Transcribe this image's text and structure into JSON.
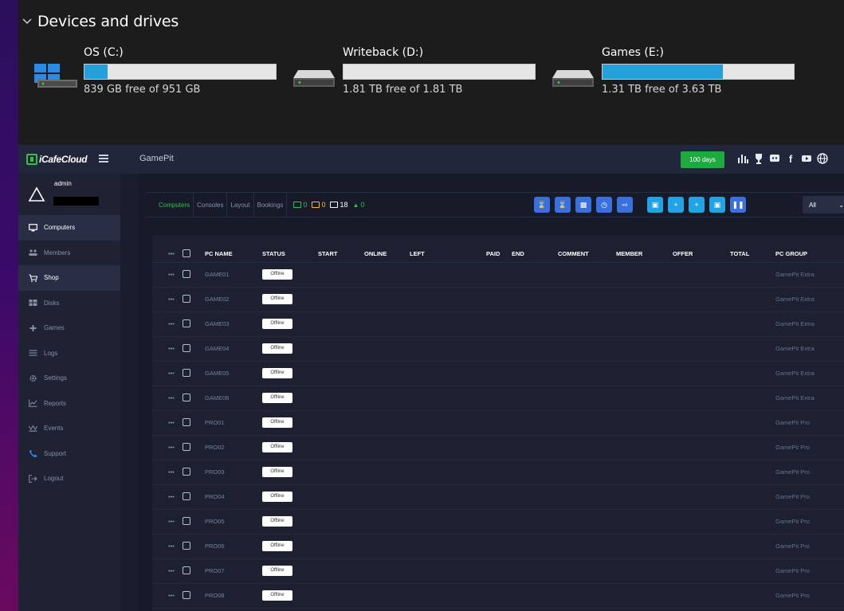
{
  "explorer": {
    "section_title": "Devices and drives",
    "drives": [
      {
        "name": "OS (C:)",
        "free_text": "839 GB free of 951 GB",
        "used_fraction": 0.12,
        "icon": "windows-drive-icon"
      },
      {
        "name": "Writeback (D:)",
        "free_text": "1.81 TB free of 1.81 TB",
        "used_fraction": 0.0,
        "icon": "hard-drive-icon"
      },
      {
        "name": "Games (E:)",
        "free_text": "1.31 TB free of 3.63 TB",
        "used_fraction": 0.63,
        "icon": "hard-drive-icon"
      }
    ]
  },
  "app": {
    "brand": "iCafeCloud",
    "cafe_name": "GamePit",
    "days_badge": "100 days",
    "top_icons": [
      "leaderboard-icon",
      "trophy-icon",
      "discord-icon",
      "facebook-icon",
      "youtube-icon",
      "globe-icon"
    ]
  },
  "profile": {
    "username": "admin"
  },
  "sidebar": {
    "items": [
      {
        "label": "Computers",
        "icon": "monitor-icon"
      },
      {
        "label": "Members",
        "icon": "members-icon"
      },
      {
        "label": "Shop",
        "icon": "cart-icon"
      },
      {
        "label": "Disks",
        "icon": "disk-icon"
      },
      {
        "label": "Games",
        "icon": "gamepad-icon"
      },
      {
        "label": "Logs",
        "icon": "list-icon"
      },
      {
        "label": "Settings",
        "icon": "gear-icon"
      },
      {
        "label": "Reports",
        "icon": "chart-icon"
      },
      {
        "label": "Events",
        "icon": "crown-icon"
      },
      {
        "label": "Support",
        "icon": "phone-icon"
      },
      {
        "label": "Logout",
        "icon": "logout-icon"
      }
    ]
  },
  "toolbar": {
    "tabs": [
      "Computers",
      "Consoles",
      "Layout",
      "Bookings"
    ],
    "stats": [
      {
        "value": "0",
        "color": "#2fc24a"
      },
      {
        "value": "0",
        "color": "#f2c21b"
      },
      {
        "value": "18",
        "color": "#ffffff"
      },
      {
        "value": "0",
        "color": "#2fc24a"
      }
    ],
    "filter_value": "All"
  },
  "table": {
    "columns": [
      "PC NAME",
      "STATUS",
      "START",
      "ONLINE",
      "LEFT",
      "PAID",
      "END",
      "COMMENT",
      "MEMBER",
      "OFFER",
      "TOTAL",
      "PC GROUP"
    ],
    "rows": [
      {
        "pc": "GAME01",
        "status": "Offline",
        "group": "GamePit Extra"
      },
      {
        "pc": "GAME02",
        "status": "Offline",
        "group": "GamePit Extra"
      },
      {
        "pc": "GAME03",
        "status": "Offline",
        "group": "GamePit Extra"
      },
      {
        "pc": "GAME04",
        "status": "Offline",
        "group": "GamePit Extra"
      },
      {
        "pc": "GAME05",
        "status": "Offline",
        "group": "GamePit Extra"
      },
      {
        "pc": "GAME06",
        "status": "Offline",
        "group": "GamePit Extra"
      },
      {
        "pc": "PRO01",
        "status": "Offline",
        "group": "GamePit Pro"
      },
      {
        "pc": "PRO02",
        "status": "Offline",
        "group": "GamePit Pro"
      },
      {
        "pc": "PRO03",
        "status": "Offline",
        "group": "GamePit Pro"
      },
      {
        "pc": "PRO04",
        "status": "Offline",
        "group": "GamePit Pro"
      },
      {
        "pc": "PRO05",
        "status": "Offline",
        "group": "GamePit Pro"
      },
      {
        "pc": "PRO06",
        "status": "Offline",
        "group": "GamePit Pro"
      },
      {
        "pc": "PRO07",
        "status": "Offline",
        "group": "GamePit Pro"
      },
      {
        "pc": "PRO08",
        "status": "Offline",
        "group": "GamePit Pro"
      }
    ]
  }
}
